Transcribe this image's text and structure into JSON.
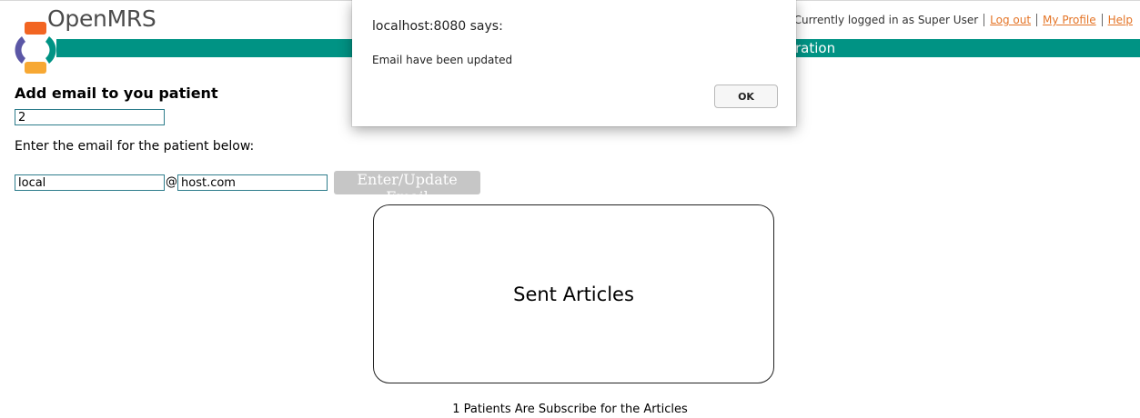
{
  "header": {
    "logo_text": "OpenMRS",
    "bar_text": "ration",
    "userbar": {
      "logged_in_text": "Currently logged in as Super User",
      "logout_label": "Log out",
      "profile_label": "My Profile",
      "help_label": "Help"
    }
  },
  "form": {
    "heading": "Add email to you patient",
    "patient_id_value": "2",
    "instruction": "Enter the email for the patient below:",
    "email_local_value": "local",
    "at_sign": "@",
    "email_domain_value": "host.com",
    "submit_label": "Enter/Update Email"
  },
  "articles": {
    "title": "Sent Articles",
    "subscribed_text": "1 Patients Are Subscribe for the Articles"
  },
  "dialog": {
    "title": "localhost:8080 says:",
    "message": "Email have been updated",
    "ok_label": "OK"
  },
  "colors": {
    "brand_teal": "#009384",
    "link_orange": "#e47426",
    "button_gray": "#c6c6c6"
  },
  "icons": {
    "logo": "openmrs-logo-icon"
  }
}
